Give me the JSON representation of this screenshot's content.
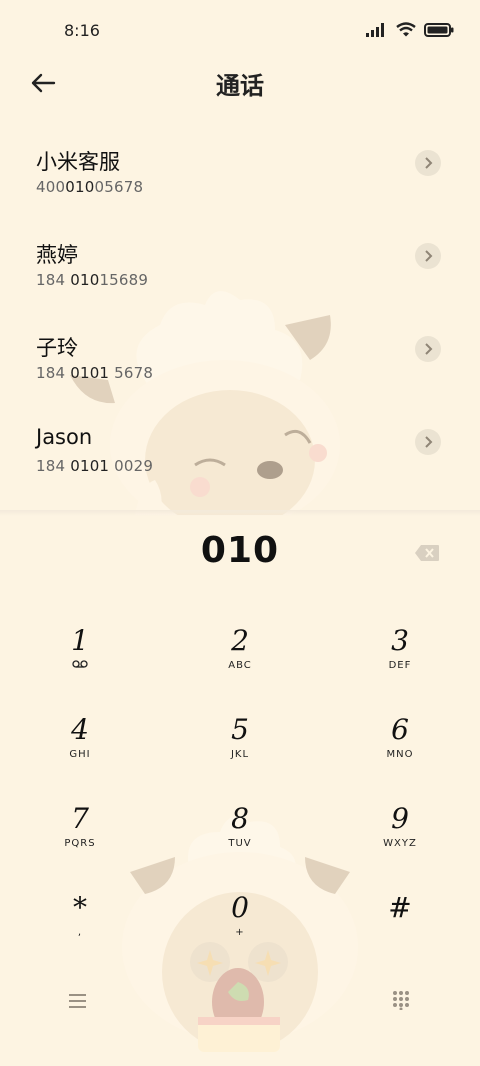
{
  "status_bar": {
    "time": "8:16"
  },
  "header": {
    "title": "通话"
  },
  "contacts": [
    {
      "name": "小米客服",
      "number_pre": "400",
      "number_hl": "010",
      "number_post": "05678"
    },
    {
      "name": "燕婷",
      "number_pre": "184 ",
      "number_hl": "010",
      "number_post": "15689"
    },
    {
      "name": "子玲",
      "number_pre": "184 ",
      "number_hl": "0101",
      "number_post": " 5678"
    },
    {
      "name": "Jason",
      "number_pre": "184 ",
      "number_hl": "0101",
      "number_post": " 0029"
    }
  ],
  "dialer": {
    "input": "010"
  },
  "keys": [
    {
      "digit": "1",
      "letters": ""
    },
    {
      "digit": "2",
      "letters": "ABC"
    },
    {
      "digit": "3",
      "letters": "DEF"
    },
    {
      "digit": "4",
      "letters": "GHI"
    },
    {
      "digit": "5",
      "letters": "JKL"
    },
    {
      "digit": "6",
      "letters": "MNO"
    },
    {
      "digit": "7",
      "letters": "PQRS"
    },
    {
      "digit": "8",
      "letters": "TUV"
    },
    {
      "digit": "9",
      "letters": "WXYZ"
    },
    {
      "digit": "*",
      "letters": ","
    },
    {
      "digit": "0",
      "letters": "+"
    },
    {
      "digit": "#",
      "letters": ""
    }
  ],
  "icons": {
    "back": "arrow-left-icon",
    "arrow": "chevron-right-icon",
    "backspace": "backspace-icon",
    "voicemail": "voicemail-icon",
    "menu": "menu-icon",
    "dialpad": "dialpad-icon"
  }
}
